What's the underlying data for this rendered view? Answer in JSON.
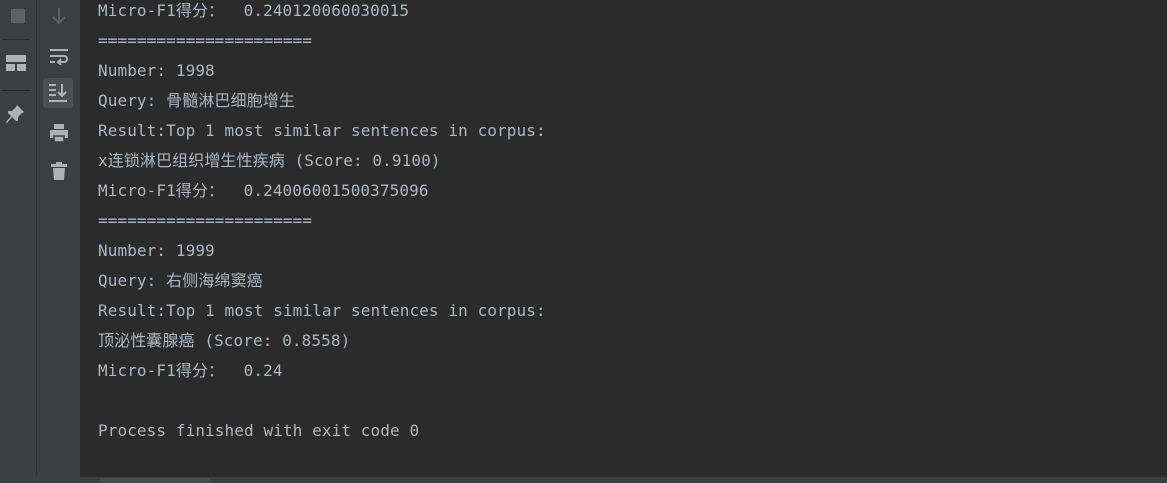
{
  "toolbar": {
    "left_icons": [
      "stop-icon",
      "layout-icon",
      "pin-icon"
    ],
    "console_icons": [
      "scroll-down-icon",
      "soft-wrap-icon",
      "scroll-to-end-icon",
      "print-icon",
      "trash-icon"
    ]
  },
  "console": {
    "lines": [
      "Micro-F1得分：  0.240120060030015",
      "======================",
      "Number: 1998",
      "Query: 骨髓淋巴细胞增生",
      "Result:Top 1 most similar sentences in corpus:",
      "x连锁淋巴组织增生性疾病 (Score: 0.9100)",
      "Micro-F1得分：  0.24006001500375096",
      "======================",
      "Number: 1999",
      "Query: 右侧海绵窦癌",
      "Result:Top 1 most similar sentences in corpus:",
      "顶泌性囊腺癌 (Score: 0.8558)",
      "Micro-F1得分：  0.24",
      "",
      "Process finished with exit code 0"
    ]
  },
  "colors": {
    "background": "#2b2b2b",
    "text": "#a9b7c6",
    "sidebar": "#3c3f41",
    "icon": "#afb1b3"
  }
}
